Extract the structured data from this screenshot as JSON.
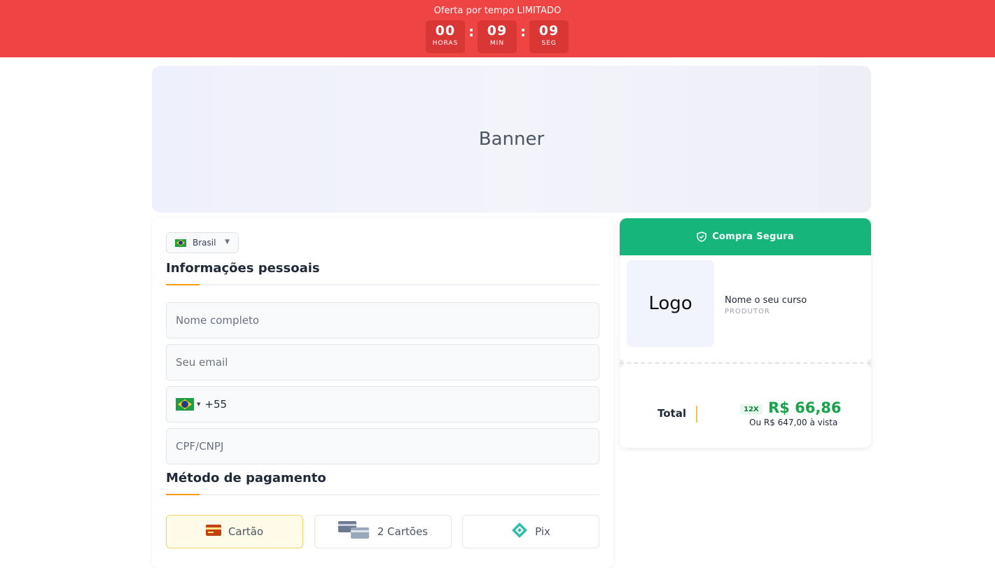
{
  "promo": {
    "text": "Oferta por tempo LIMITADO",
    "timer": {
      "hours": "00",
      "hours_label": "HORAS",
      "minutes": "09",
      "minutes_label": "MIN",
      "seconds": "09",
      "seconds_label": "SEG",
      "separator": ":"
    },
    "color": "#ef4444"
  },
  "banner": {
    "text": "Banner"
  },
  "form": {
    "country": {
      "label": "Brasil",
      "flag_icon": "brazil-flag-icon"
    },
    "personal_title": "Informações pessoais",
    "fields": {
      "name_placeholder": "Nome completo",
      "email_placeholder": "Seu email",
      "phone_value": "+55",
      "doc_placeholder": "CPF/CNPJ"
    },
    "payment_title": "Método de pagamento",
    "payment_methods": [
      {
        "label": "Cartão",
        "icon": "credit-card-icon",
        "selected": true
      },
      {
        "label": "2 Cartões",
        "icon": "two-cards-icon",
        "selected": false
      },
      {
        "label": "Pix",
        "icon": "pix-icon",
        "selected": false
      }
    ]
  },
  "summary": {
    "secure_label": "Compra Segura",
    "secure_icon": "shield-check-icon",
    "logo_text": "Logo",
    "course_name": "Nome o seu curso",
    "producer_label": "PRODUTOR",
    "total_label": "Total",
    "installments_badge": "12X",
    "installment_price": "R$ 66,86",
    "cash_price_text": "Ou R$ 647,00 à vista",
    "accent": "#16b57c"
  }
}
